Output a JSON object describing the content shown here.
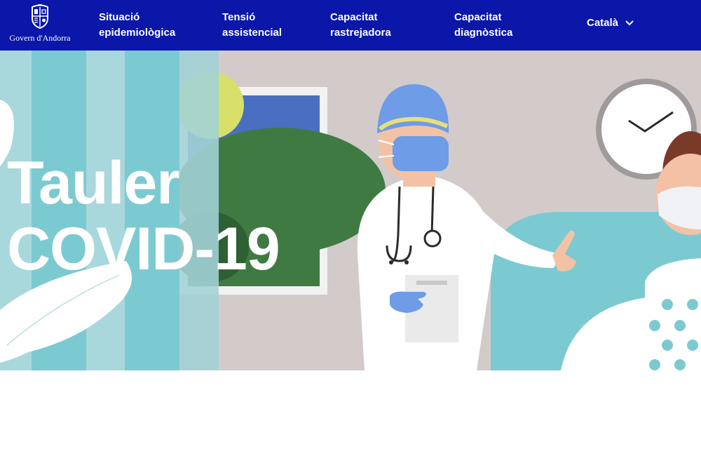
{
  "brand": {
    "name": "Govern d'Andorra",
    "logo_icon": "andorra-coat-of-arms-icon"
  },
  "nav": {
    "items": [
      {
        "line1": "Situació",
        "line2": "epidemiològica"
      },
      {
        "line1": "Tensió",
        "line2": "assistencial"
      },
      {
        "line1": "Capacitat",
        "line2": "rastrejadora"
      },
      {
        "line1": "Capacitat",
        "line2": "diagnòstica"
      }
    ],
    "language": {
      "selected": "Català",
      "icon": "chevron-down-icon"
    }
  },
  "hero": {
    "title_line1": "Tauler",
    "title_line2": "COVID-19",
    "illustration": "doctor-in-hospital-room-illustration"
  },
  "colors": {
    "nav_bg": "#0a17a8",
    "curtain_teal": "#8ccdd3",
    "wall": "#d2cbca",
    "mask_blue": "#6e9ce6"
  }
}
